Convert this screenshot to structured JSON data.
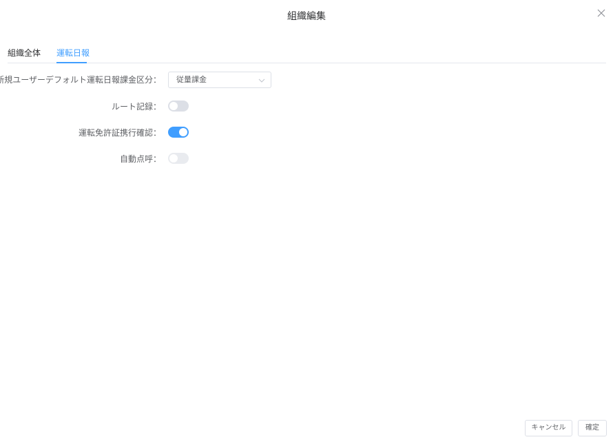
{
  "dialog": {
    "title": "組織編集",
    "close_icon": "close-icon"
  },
  "tabs": [
    {
      "label": "組織全体",
      "active": false
    },
    {
      "label": "運転日報",
      "active": true
    }
  ],
  "form": {
    "billing": {
      "required_mark": "*",
      "label": "新規ユーザーデフォルト運転日報課金区分：",
      "value": "従量課金"
    },
    "route_record": {
      "label": "ルート記録：",
      "state": "off"
    },
    "license_check": {
      "label": "運転免許証携行確認：",
      "state": "on"
    },
    "auto_rollcall": {
      "label": "自動点呼：",
      "state": "disabled"
    }
  },
  "footer": {
    "cancel_label": "キャンセル",
    "ok_label": "確定"
  },
  "colors": {
    "accent": "#409eff",
    "required": "#f56c6c",
    "border": "#dcdfe6"
  }
}
